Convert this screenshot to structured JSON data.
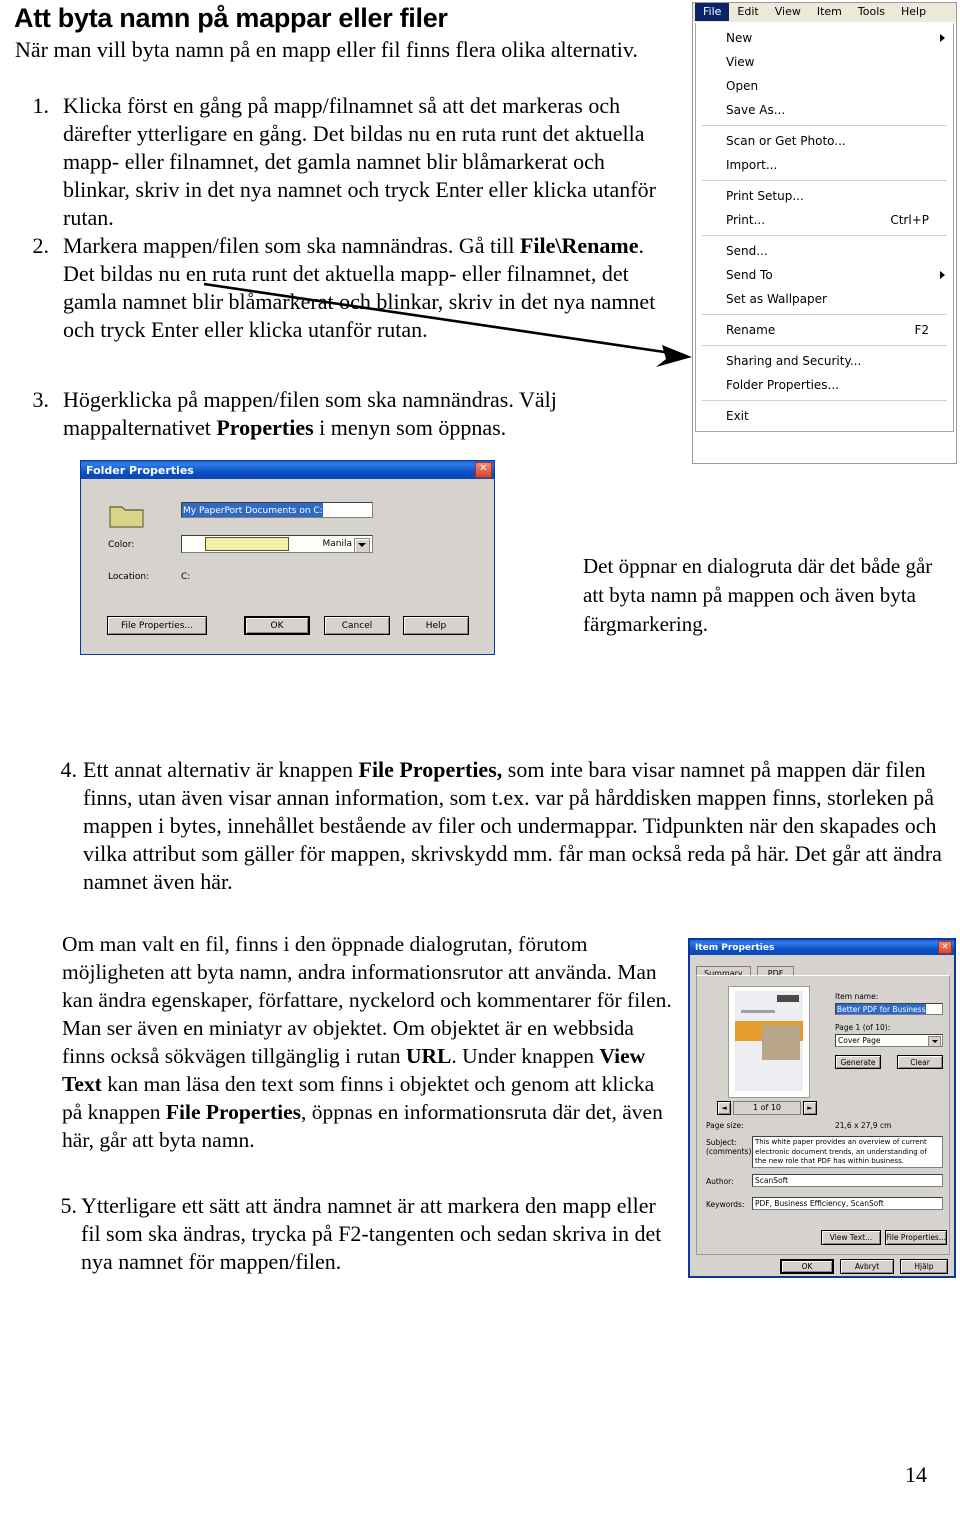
{
  "document": {
    "title": "Att byta namn på mappar eller filer",
    "intro": "När man vill byta namn på en mapp eller fil finns flera olika alternativ.",
    "page_number": "14"
  },
  "steps": [
    {
      "num": "1.",
      "text_parts": [
        {
          "text": "Klicka först en gång på mapp/filnamnet så att det markeras och därefter ytterligare en gång. Det bildas nu en ruta runt det aktuella mapp- eller filnamnet, det gamla namnet blir blåmarkerat och blinkar, skriv in det nya namnet och tryck Enter eller klicka utanför rutan.",
          "bold": false
        }
      ]
    },
    {
      "num": "2.",
      "text_parts": [
        {
          "text": "Markera mappen/filen som ska namnändras. Gå till ",
          "bold": false
        },
        {
          "text": "File\\Rename",
          "bold": true
        },
        {
          "text": ". Det bildas nu en ruta runt det aktuella mapp- eller filnamnet, det gamla namnet blir blåmarkerat och blinkar, skriv in det nya namnet och tryck Enter eller klicka utanför rutan.",
          "bold": false
        }
      ]
    },
    {
      "num": "3.",
      "text_parts": [
        {
          "text": "Högerklicka på mappen/filen som ska namnändras. Välj mappalternativet ",
          "bold": false
        },
        {
          "text": "Properties",
          "bold": true
        },
        {
          "text": " i menyn som öppnas.",
          "bold": false
        }
      ]
    },
    {
      "num": "4.",
      "text_parts": [
        {
          "text": "Ett annat alternativ är knappen ",
          "bold": false
        },
        {
          "text": "File Properties,",
          "bold": true
        },
        {
          "text": " som inte bara visar namnet på mappen där filen finns, utan även visar annan information, som t.ex. var på hårddisken mappen finns, storleken på mappen i bytes, innehållet bestående av filer och undermappar. Tidpunkten när den skapades och vilka attribut som gäller för mappen, skrivskydd mm. får man också reda på här. Det går att ändra namnet även här.",
          "bold": false
        }
      ]
    },
    {
      "num": "5.",
      "text_parts": [
        {
          "text": "Ytterligare ett sätt att ändra namnet är att markera den mapp eller fil som ska ändras, trycka på F2-tangenten och sedan skriva in det nya namnet för mappen/filen.",
          "bold": false
        }
      ]
    }
  ],
  "caption_right_of_folder_dialog": "Det öppnar en dialogruta där det både går att byta namn på mappen och även byta färgmarkering.",
  "file_properties_paragraph_parts": [
    {
      "text": "Om man valt en fil, finns i den öppnade dialogrutan, förutom möjligheten att byta namn, andra informationsrutor att använda. Man kan ändra egenskaper, författare, nyckelord och kommentarer för filen. Man ser även en miniatyr av objektet. Om objektet är en webbsida finns också sökvägen tillgänglig i rutan ",
      "bold": false
    },
    {
      "text": "URL",
      "bold": true
    },
    {
      "text": ". Under knappen ",
      "bold": false
    },
    {
      "text": "View Text",
      "bold": true
    },
    {
      "text": " kan man läsa den text som finns i objektet och genom att klicka på knappen ",
      "bold": false
    },
    {
      "text": "File Properties",
      "bold": true
    },
    {
      "text": ", öppnas en informationsruta där det, även här, går att byta namn.",
      "bold": false
    }
  ],
  "file_menu": {
    "menubar": [
      {
        "label": "File",
        "selected": true
      },
      {
        "label": "Edit",
        "selected": false
      },
      {
        "label": "View",
        "selected": false
      },
      {
        "label": "Item",
        "selected": false
      },
      {
        "label": "Tools",
        "selected": false
      },
      {
        "label": "Help",
        "selected": false
      }
    ],
    "items": [
      {
        "label": "New",
        "accel": "",
        "submenu": true,
        "separator_after": false
      },
      {
        "label": "View",
        "accel": "",
        "submenu": false,
        "separator_after": false
      },
      {
        "label": "Open",
        "accel": "",
        "submenu": false,
        "separator_after": false
      },
      {
        "label": "Save As...",
        "accel": "",
        "submenu": false,
        "separator_after": true
      },
      {
        "label": "Scan or Get Photo...",
        "accel": "",
        "submenu": false,
        "separator_after": false
      },
      {
        "label": "Import...",
        "accel": "",
        "submenu": false,
        "separator_after": true
      },
      {
        "label": "Print Setup...",
        "accel": "",
        "submenu": false,
        "separator_after": false
      },
      {
        "label": "Print...",
        "accel": "Ctrl+P",
        "submenu": false,
        "separator_after": true
      },
      {
        "label": "Send...",
        "accel": "",
        "submenu": false,
        "separator_after": false
      },
      {
        "label": "Send To",
        "accel": "",
        "submenu": true,
        "separator_after": false
      },
      {
        "label": "Set as Wallpaper",
        "accel": "",
        "submenu": false,
        "separator_after": true
      },
      {
        "label": "Rename",
        "accel": "F2",
        "submenu": false,
        "separator_after": true
      },
      {
        "label": "Sharing and Security...",
        "accel": "",
        "submenu": false,
        "separator_after": false
      },
      {
        "label": "Folder Properties...",
        "accel": "",
        "submenu": false,
        "separator_after": true
      },
      {
        "label": "Exit",
        "accel": "",
        "submenu": false,
        "separator_after": false
      }
    ]
  },
  "folder_properties_dialog": {
    "title": "Folder Properties",
    "close_label": "✕",
    "name_value": "My PaperPort Documents on C:",
    "color_label": "Color:",
    "color_value": "Manila",
    "color_swatch": "#f2efa8",
    "location_label": "Location:",
    "location_value": "C:",
    "buttons": [
      "File  Properties...",
      "OK",
      "Cancel",
      "Help"
    ]
  },
  "item_properties_dialog": {
    "title": "Item Properties",
    "close_label": "✕",
    "tabs": [
      "Summary",
      "PDF"
    ],
    "active_tab": "Summary",
    "item_name_label": "Item name:",
    "item_name_value": "Better PDF for Business",
    "page_label": "Page 1 (of 10):",
    "page_select_value": "Cover Page",
    "generate_button": "Generate",
    "clear_button": "Clear",
    "pager_value": "1 of 10",
    "page_size_label": "Page size:",
    "page_size_value": "21,6 x 27,9 cm",
    "subject_label": "Subject:",
    "subject_label2": "(comments)",
    "subject_value": "This white paper provides an overview of current electronic document trends, an understanding of the new role that PDF has within business.",
    "author_label": "Author:",
    "author_value": "ScanSoft",
    "keywords_label": "Keywords:",
    "keywords_value": "PDF, Business Efficiency, ScanSoft",
    "view_text_button": "View Text...",
    "file_properties_button": "File Properties...",
    "ok_button": "OK",
    "cancel_button": "Avbryt",
    "help_button": "Hjälp"
  },
  "colors": {
    "title_bar_blue": "#0a4fc4",
    "menu_highlight": "#0a246a",
    "dialog_face": "#d6d3ce",
    "selection_blue": "#316ac5",
    "thumbnail_accent": "#e49d2a"
  }
}
